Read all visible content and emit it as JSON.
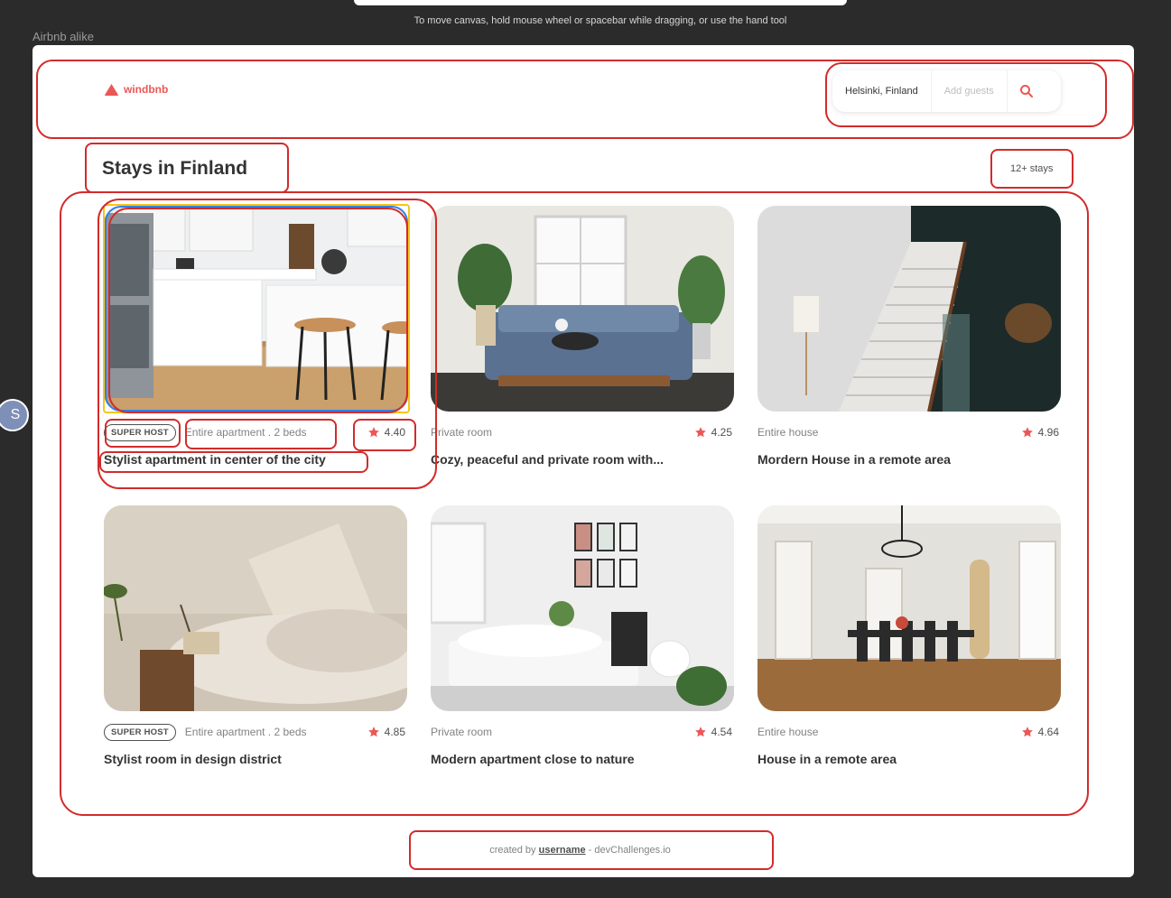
{
  "canvas": {
    "hint": "To move canvas, hold mouse wheel or spacebar while dragging, or use the hand tool",
    "frame_label": "Airbnb alike",
    "side_avatar": "S"
  },
  "header": {
    "logo_text": "windbnb",
    "search": {
      "location": "Helsinki, Finland",
      "guests_placeholder": "Add guests"
    }
  },
  "main": {
    "title": "Stays in Finland",
    "count": "12+ stays",
    "stays": [
      {
        "superhost": true,
        "superhost_label": "SUPER HOST",
        "type": "Entire apartment . 2 beds",
        "rating": "4.40",
        "title": "Stylist apartment in center of the city",
        "photo": "kitchen"
      },
      {
        "superhost": false,
        "superhost_label": "",
        "type": "Private room",
        "rating": "4.25",
        "title": "Cozy, peaceful and private room with...",
        "photo": "bedroom-dog"
      },
      {
        "superhost": false,
        "superhost_label": "",
        "type": "Entire house",
        "rating": "4.96",
        "title": "Mordern House in a remote area",
        "photo": "staircase"
      },
      {
        "superhost": true,
        "superhost_label": "SUPER HOST",
        "type": "Entire apartment . 2 beds",
        "rating": "4.85",
        "title": "Stylist room in design district",
        "photo": "rustic-bedroom"
      },
      {
        "superhost": false,
        "superhost_label": "",
        "type": "Private room",
        "rating": "4.54",
        "title": "Modern apartment close to nature",
        "photo": "white-bedroom"
      },
      {
        "superhost": false,
        "superhost_label": "",
        "type": "Entire house",
        "rating": "4.64",
        "title": "House in a remote area",
        "photo": "dining-room"
      }
    ]
  },
  "footer": {
    "prefix": "created by",
    "username": "username",
    "suffix": "- devChallenges.io"
  },
  "colors": {
    "brand": "#eb5757",
    "annotation": "#d22b2b",
    "selection_yellow": "#f5c518",
    "selection_blue": "#2f80ed"
  }
}
